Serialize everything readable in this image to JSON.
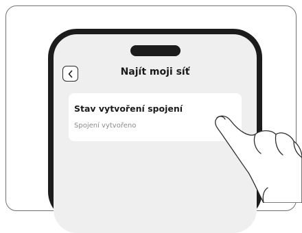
{
  "screen": {
    "title": "Najít moji síť"
  },
  "status_card": {
    "title": "Stav vytvoření spojení",
    "subtitle": "Spojení vytvořeno"
  },
  "icons": {
    "back": "chevron-left-icon",
    "hand": "hand-pointer-icon"
  }
}
